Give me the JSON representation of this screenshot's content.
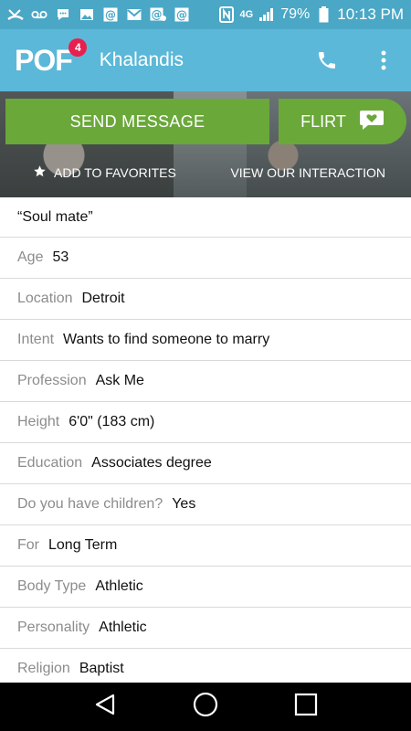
{
  "status_bar": {
    "icons": [
      "missed-call-icon",
      "voicemail-icon",
      "chat-icon",
      "image-icon",
      "at-icon",
      "mail-icon",
      "gmail-icon",
      "at-icon"
    ],
    "network": "4G",
    "battery": "79%",
    "time": "10:13 PM"
  },
  "app_bar": {
    "logo": "POF",
    "badge": "4",
    "username": "Khalandis"
  },
  "actions": {
    "send_message": "SEND MESSAGE",
    "flirt": "FLIRT",
    "add_favorites": "ADD TO FAVORITES",
    "view_interaction": "VIEW OUR INTERACTION"
  },
  "profile": {
    "headline": "“Soul mate”",
    "details": [
      {
        "label": "Age",
        "value": "53"
      },
      {
        "label": "Location",
        "value": "Detroit"
      },
      {
        "label": "Intent",
        "value": "Wants to find someone to marry"
      },
      {
        "label": "Profession",
        "value": "Ask Me"
      },
      {
        "label": "Height",
        "value": "6'0\" (183 cm)"
      },
      {
        "label": "Education",
        "value": "Associates degree"
      },
      {
        "label": "Do you have children?",
        "value": "Yes"
      },
      {
        "label": "For",
        "value": "Long Term"
      },
      {
        "label": "Body Type",
        "value": "Athletic"
      },
      {
        "label": "Personality",
        "value": "Athletic"
      },
      {
        "label": "Religion",
        "value": "Baptist"
      }
    ]
  },
  "colors": {
    "status_bar": "#4aa7c6",
    "app_bar": "#5bb8d8",
    "button_green": "#6aa83a",
    "badge": "#e8204f",
    "label_gray": "#8c8c8c"
  }
}
